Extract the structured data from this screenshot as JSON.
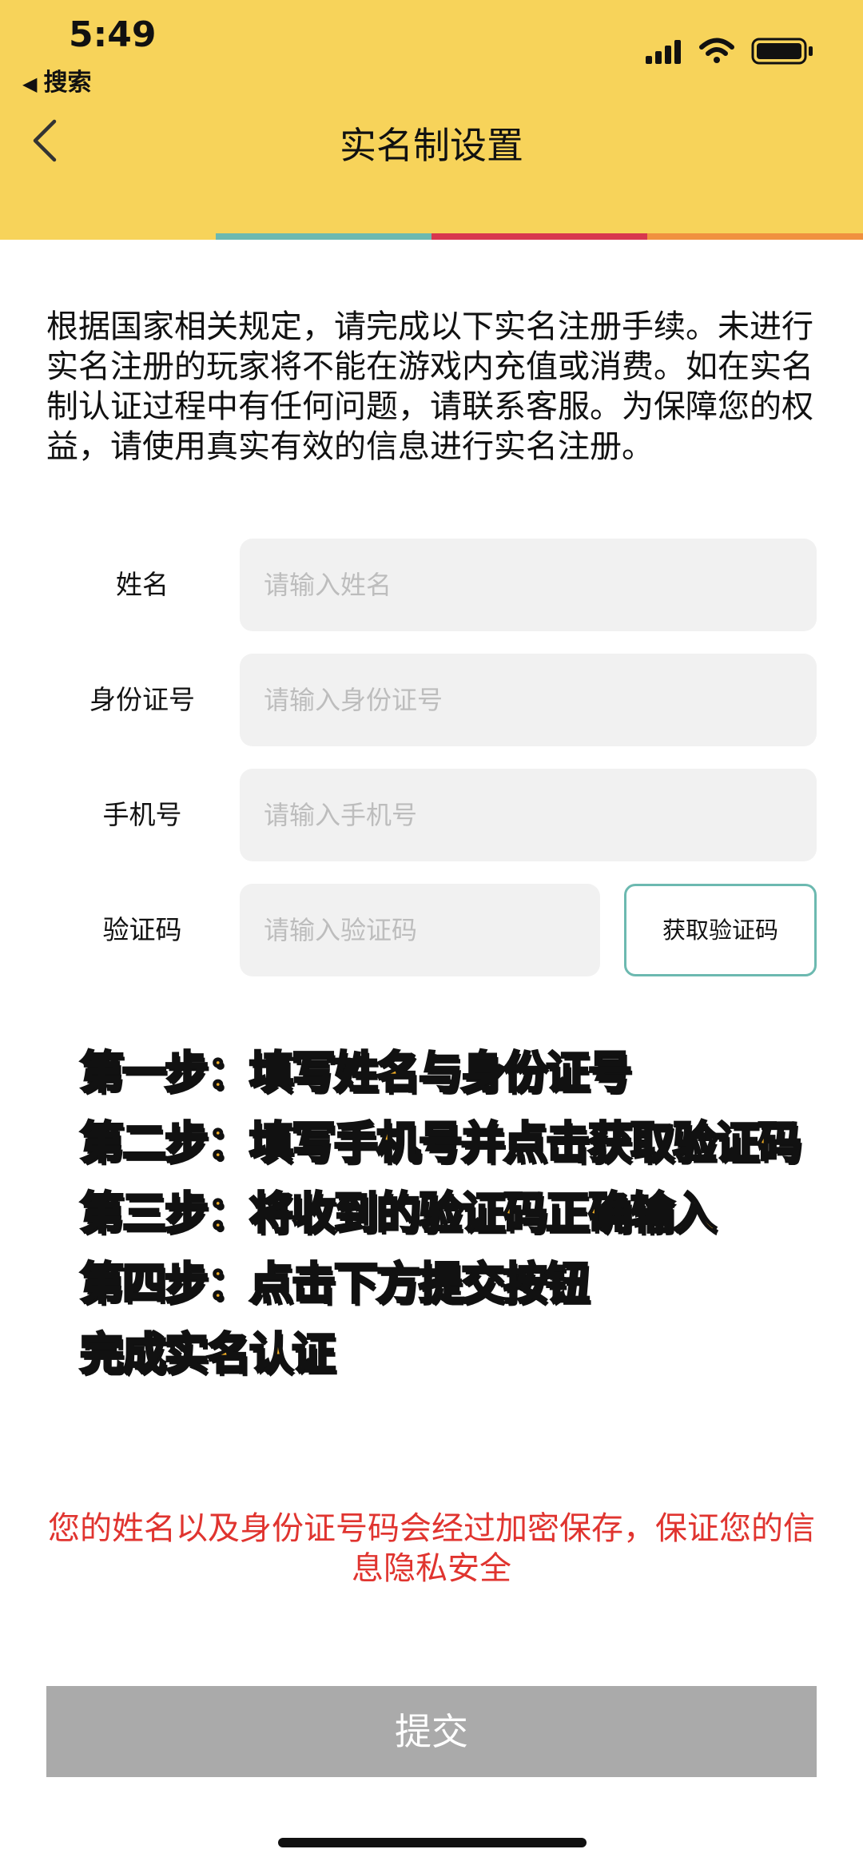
{
  "status_bar": {
    "time": "5:49",
    "back_app_label": "搜索",
    "icons": [
      "signal-icon",
      "wifi-icon",
      "battery-icon"
    ]
  },
  "nav": {
    "title": "实名制设置",
    "back_icon": "chevron-left-icon"
  },
  "colors": {
    "header_bg": "#F7D35A",
    "stripe": [
      "#F7D35A",
      "#6CB9B0",
      "#D8374E",
      "#F0913F"
    ],
    "input_bg": "#F1F1F1",
    "notice": "#E0342F",
    "submit_bg": "#AAAAAA",
    "step_fill": "#F5B025"
  },
  "intro_text": "根据国家相关规定，请完成以下实名注册手续。未进行实名注册的玩家将不能在游戏内充值或消费。如在实名制认证过程中有任何问题，请联系客服。为保障您的权益，请使用真实有效的信息进行实名注册。",
  "form": {
    "name": {
      "label": "姓名",
      "placeholder": "请输入姓名",
      "value": ""
    },
    "id_number": {
      "label": "身份证号",
      "placeholder": "请输入身份证号",
      "value": ""
    },
    "phone": {
      "label": "手机号",
      "placeholder": "请输入手机号",
      "value": ""
    },
    "code": {
      "label": "验证码",
      "placeholder": "请输入验证码",
      "value": "",
      "button": "获取验证码"
    }
  },
  "steps": [
    "第一步：填写姓名与身份证号",
    "第二步：填写手机号并点击获取验证码",
    "第三步：将收到的验证码正确输入",
    "第四步：点击下方提交按钮",
    "完成实名认证"
  ],
  "notice": "您的姓名以及身份证号码会经过加密保存，保证您的信息隐私安全",
  "submit_label": "提交"
}
